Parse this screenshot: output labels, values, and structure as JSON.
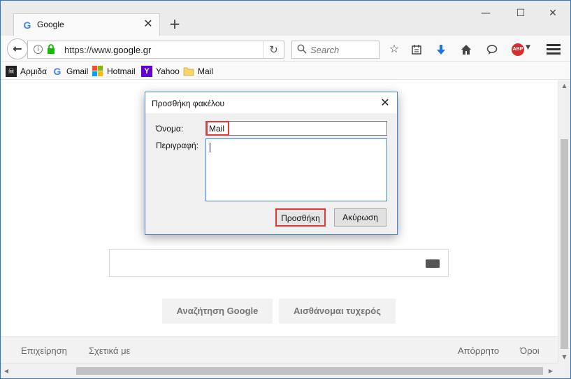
{
  "browser": {
    "tab_title": "Google",
    "tab_favicon": "G",
    "tab_close": "✕",
    "new_tab": "+",
    "window_min": "—",
    "window_max": "☐",
    "window_close": "✕",
    "url_prefix": "https://www.",
    "url_host": "google.gr",
    "search_placeholder": "Search",
    "abp_label": "ABP"
  },
  "bookmarks": [
    {
      "label": "Αρμιδα",
      "icon": "pirate-flag-icon"
    },
    {
      "label": "Gmail",
      "icon": "google-g-icon"
    },
    {
      "label": "Hotmail",
      "icon": "windows-logo-icon"
    },
    {
      "label": "Yahoo",
      "icon": "yahoo-y-icon"
    },
    {
      "label": "Mail",
      "icon": "folder-icon"
    }
  ],
  "page": {
    "search_button": "Αναζήτηση Google",
    "lucky_button": "Αισθάνομαι τυχερός",
    "footer_left": [
      "Επιχείρηση",
      "Σχετικά με"
    ],
    "footer_right": [
      "Απόρρητο",
      "Όροι"
    ]
  },
  "dialog": {
    "title": "Προσθήκη φακέλου",
    "name_label": "Όνομα:",
    "name_value": "Mail",
    "description_label": "Περιγραφή:",
    "description_value": "",
    "add_button": "Προσθήκη",
    "cancel_button": "Ακύρωση"
  },
  "colors": {
    "window_border": "#2b78c5",
    "highlight": "#e53935",
    "abp_red": "#d32f2f",
    "download_blue": "#1a73e8"
  }
}
